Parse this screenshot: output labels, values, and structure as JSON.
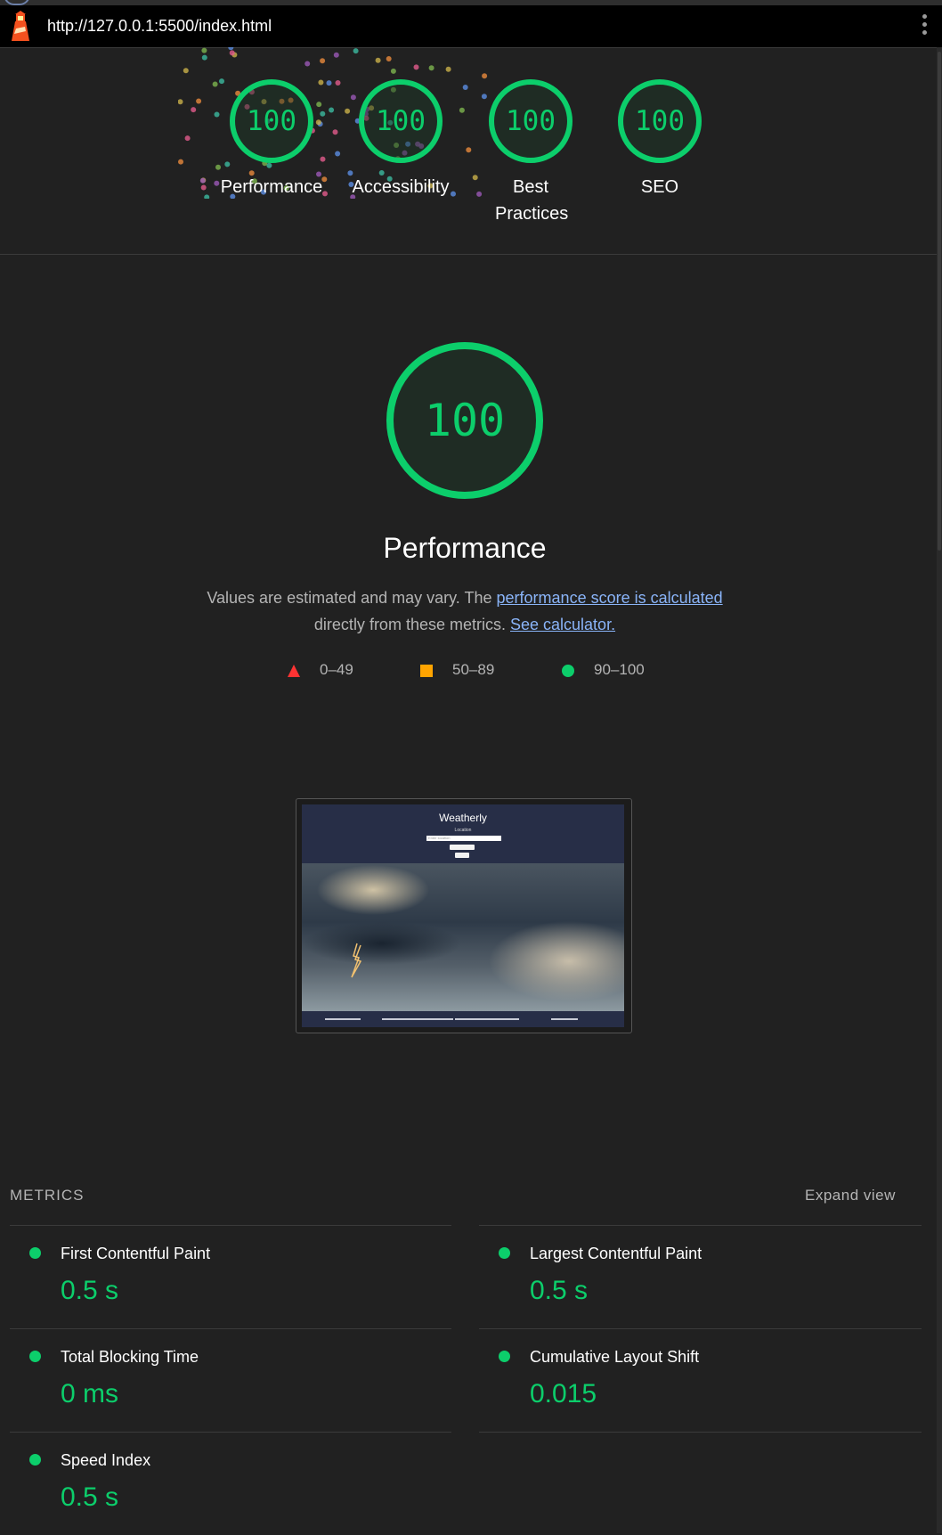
{
  "browser": {
    "url": "http://127.0.0.1:5500/index.html"
  },
  "summary_gauges": [
    {
      "score": "100",
      "label": "Performance"
    },
    {
      "score": "100",
      "label": "Accessibility"
    },
    {
      "score": "100",
      "label": "Best Practices"
    },
    {
      "score": "100",
      "label": "SEO"
    }
  ],
  "performance": {
    "score": "100",
    "title": "Performance",
    "desc_prefix": "Values are estimated and may vary. The",
    "desc_link": "performance score is calculated",
    "desc_middle": "directly from these metrics.",
    "calc_link": "See calculator.",
    "legend": [
      {
        "shape": "triangle",
        "color": "#ff3333",
        "range": "0–49"
      },
      {
        "shape": "square",
        "color": "#ffa400",
        "range": "50–89"
      },
      {
        "shape": "circle",
        "color": "#0cce6b",
        "range": "90–100"
      }
    ]
  },
  "screenshot": {
    "site_title": "Weatherly",
    "location_label": "Location",
    "input_placeholder": "Enter location"
  },
  "metrics": {
    "title": "METRICS",
    "expand_label": "Expand view",
    "items": [
      {
        "name": "First Contentful Paint",
        "value": "0.5 s"
      },
      {
        "name": "Largest Contentful Paint",
        "value": "0.5 s"
      },
      {
        "name": "Total Blocking Time",
        "value": "0 ms"
      },
      {
        "name": "Cumulative Layout Shift",
        "value": "0.015"
      },
      {
        "name": "Speed Index",
        "value": "0.5 s"
      }
    ]
  },
  "colors": {
    "pass": "#0cce6b",
    "background": "#212121",
    "link": "#8ab4f8"
  }
}
